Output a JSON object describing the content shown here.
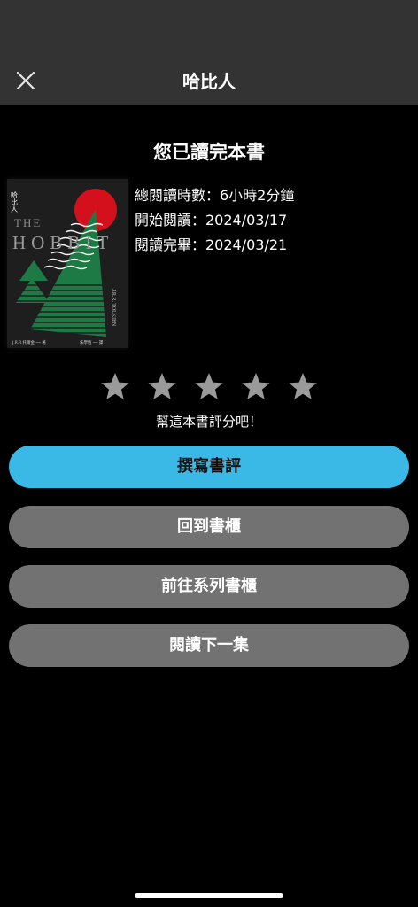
{
  "header": {
    "title": "哈比人",
    "close_icon": "close-icon"
  },
  "completion": {
    "title": "您已讀完本書"
  },
  "book": {
    "cover": {
      "vertical_title": "哈比人",
      "title_line1": "THE",
      "title_line2": "HOBBIT",
      "author_spine": "J.R.R. TOLKIEN",
      "bottom_left": "J.R.R.托爾金 ── 著",
      "bottom_right": "朱學恆 ── 譯"
    },
    "stats": {
      "total_time": "總閱讀時數：6小時2分鐘",
      "start_date": "開始閱讀：2024/03/17",
      "finish_date": "閱讀完畢：2024/03/21"
    }
  },
  "rating": {
    "stars": 5,
    "star_icon": "star-icon",
    "star_color": "#9a9a9a",
    "hint": "幫這本書評分吧！"
  },
  "actions": {
    "write_review": "撰寫書評",
    "back_to_shelf": "回到書櫃",
    "go_to_series_shelf": "前往系列書櫃",
    "read_next": "閱讀下一集"
  },
  "colors": {
    "primary_button": "#3ab8e6",
    "secondary_button": "#727272",
    "header_bg": "#333333",
    "background": "#000000"
  }
}
